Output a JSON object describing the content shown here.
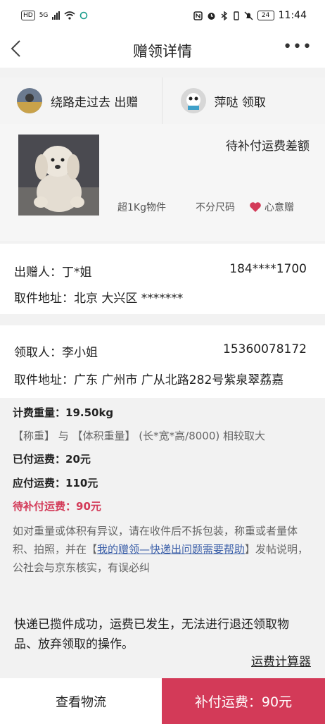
{
  "status_bar": {
    "hd": "HD",
    "network": "5G",
    "time": "11:44",
    "battery": "24"
  },
  "header": {
    "title": "赠领详情",
    "more": "•••"
  },
  "parties": {
    "giver_text": "绕路走过去 出赠",
    "receiver_text": "萍哒 领取"
  },
  "item": {
    "status": "待补付运费差额",
    "tags": [
      "超1Kg物件",
      "不分尺码",
      "心意赠"
    ]
  },
  "giver": {
    "name_label": "出赠人：丁*姐",
    "phone": "184****1700",
    "address": "取件地址：北京 大兴区 *******"
  },
  "receiver": {
    "name_label": "领取人：李小姐",
    "phone": "15360078172",
    "address": "取件地址：广东 广州市 广从北路282号紫泉翠荔嘉"
  },
  "fee": {
    "weight": "计费重量：19.50kg",
    "weight_note": "【称重】 与 【体积重量】 (长*宽*高/8000) 相较取大",
    "paid": "已付运费：20元",
    "due": "应付运费：110元",
    "pending": "待补付运费：90元",
    "dispute_prefix": "如对重量或体积有异议，请在收件后不拆包装，称重或者量体积、拍照，并在【",
    "dispute_link": "我的赠领—快递出问题需要帮助",
    "dispute_suffix": "】发帖说明，公社会与京东核实，有误必纠"
  },
  "notice": {
    "text": "快递已揽件成功，运费已发生，无法进行退还领取物品、放弃领取的操作。",
    "calculator": "运费计算器"
  },
  "actions": {
    "logistics": "查看物流",
    "pay": "补付运费：90元"
  }
}
